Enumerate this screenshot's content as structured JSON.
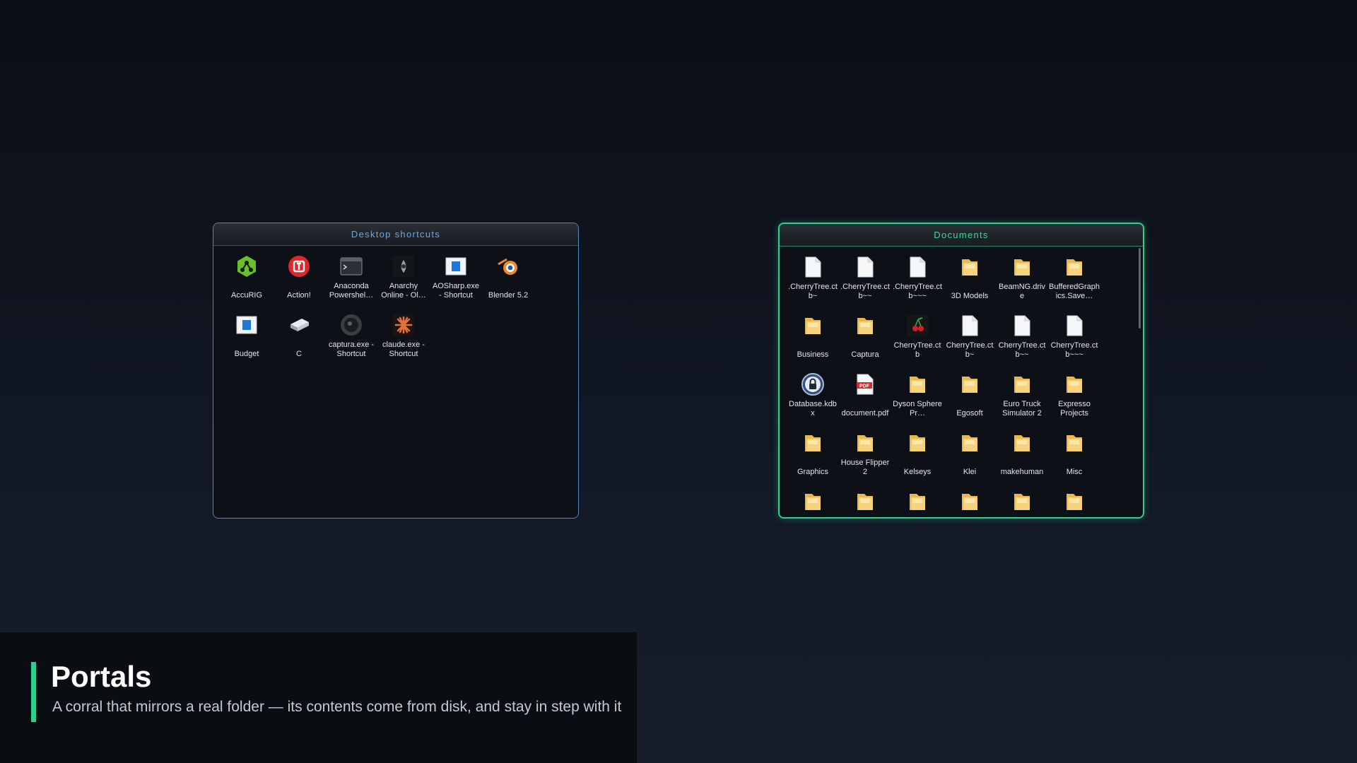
{
  "fences": {
    "desktop": {
      "title": "Desktop shortcuts",
      "items": [
        {
          "label": "AccuRIG",
          "icon": "accurig-icon"
        },
        {
          "label": "Action!",
          "icon": "action-icon"
        },
        {
          "label": "Anaconda Powershel…",
          "icon": "terminal-icon"
        },
        {
          "label": "Anarchy Online - Ol…",
          "icon": "anarchy-online-icon"
        },
        {
          "label": "AOSharp.exe - Shortcut",
          "icon": "app-window-icon"
        },
        {
          "label": "Blender 5.2",
          "icon": "blender-icon"
        },
        {
          "label": "Budget",
          "icon": "app-window-icon"
        },
        {
          "label": "C",
          "icon": "drive-icon"
        },
        {
          "label": "captura.exe - Shortcut",
          "icon": "captura-icon"
        },
        {
          "label": "claude.exe - Shortcut",
          "icon": "claude-icon"
        }
      ]
    },
    "documents": {
      "title": "Documents",
      "items": [
        {
          "label": ".CherryTree.ctb~",
          "icon": "file-icon"
        },
        {
          "label": ".CherryTree.ctb~~",
          "icon": "file-icon"
        },
        {
          "label": ".CherryTree.ctb~~~",
          "icon": "file-icon"
        },
        {
          "label": "3D Models",
          "icon": "folder-icon"
        },
        {
          "label": "BeamNG.drive",
          "icon": "folder-icon"
        },
        {
          "label": "BufferedGraphics.Save…",
          "icon": "folder-icon"
        },
        {
          "label": "Business",
          "icon": "folder-icon"
        },
        {
          "label": "Captura",
          "icon": "folder-icon"
        },
        {
          "label": "CherryTree.ctb",
          "icon": "cherrytree-icon"
        },
        {
          "label": "CherryTree.ctb~",
          "icon": "file-icon"
        },
        {
          "label": "CherryTree.ctb~~",
          "icon": "file-icon"
        },
        {
          "label": "CherryTree.ctb~~~",
          "icon": "file-icon"
        },
        {
          "label": "Database.kdbx",
          "icon": "keepass-icon"
        },
        {
          "label": "document.pdf",
          "icon": "pdf-icon"
        },
        {
          "label": "Dyson Sphere Pr…",
          "icon": "folder-icon"
        },
        {
          "label": "Egosoft",
          "icon": "folder-icon"
        },
        {
          "label": "Euro Truck Simulator 2",
          "icon": "folder-icon"
        },
        {
          "label": "Expresso Projects",
          "icon": "folder-icon"
        },
        {
          "label": "Graphics",
          "icon": "folder-icon"
        },
        {
          "label": "House Flipper 2",
          "icon": "folder-icon"
        },
        {
          "label": "Kelseys",
          "icon": "folder-icon"
        },
        {
          "label": "Klei",
          "icon": "folder-icon"
        },
        {
          "label": "makehuman",
          "icon": "folder-icon"
        },
        {
          "label": "Misc",
          "icon": "folder-icon"
        },
        {
          "label": "",
          "icon": "folder-icon"
        },
        {
          "label": "",
          "icon": "folder-icon"
        },
        {
          "label": "",
          "icon": "folder-icon"
        },
        {
          "label": "",
          "icon": "folder-icon"
        },
        {
          "label": "",
          "icon": "folder-icon"
        },
        {
          "label": "",
          "icon": "folder-icon"
        }
      ]
    }
  },
  "caption": {
    "title": "Portals",
    "subtitle": "A corral that mirrors a real folder — its contents come from disk, and stay in step with it"
  },
  "colors": {
    "desktop_accent": "#4f87c2",
    "documents_accent": "#2fd08d"
  }
}
